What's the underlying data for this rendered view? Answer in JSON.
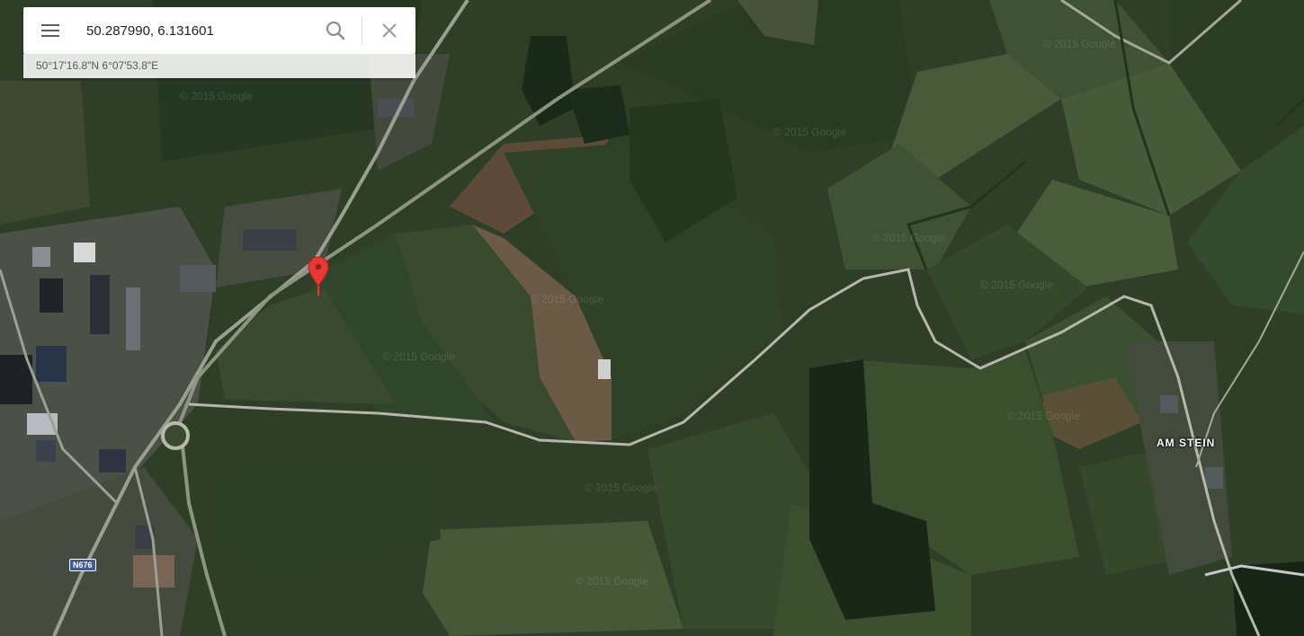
{
  "search": {
    "query": "50.287990, 6.131601",
    "menu_icon": "menu-icon",
    "search_icon": "search-icon",
    "close_icon": "close-icon"
  },
  "coordinates_dms": "50°17'16.8\"N 6°07'53.8\"E",
  "map": {
    "type": "satellite",
    "marker_color": "#e53935",
    "labels": {
      "place": "AM STEIN",
      "route": "N676"
    },
    "watermark": "© 2015 Google"
  }
}
